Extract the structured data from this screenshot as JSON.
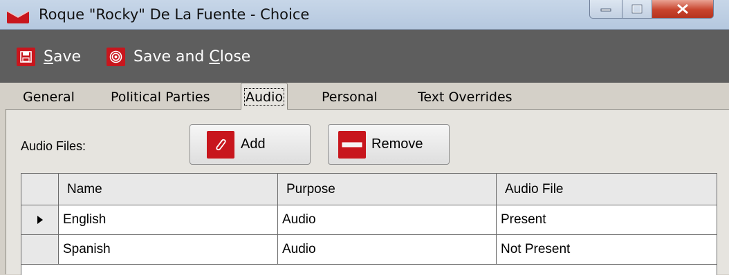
{
  "window": {
    "title": "Roque \"Rocky\" De La Fuente - Choice"
  },
  "toolbar": {
    "save_prefix": "",
    "save_mnemonic": "S",
    "save_rest": "ave",
    "saveclose_prefix": "Save and ",
    "saveclose_mnemonic": "C",
    "saveclose_rest": "lose"
  },
  "tabs": [
    {
      "label": "General"
    },
    {
      "label": "Political Parties"
    },
    {
      "label": "Audio"
    },
    {
      "label": "Personal"
    },
    {
      "label": "Text Overrides"
    }
  ],
  "active_tab": "Audio",
  "audio": {
    "label": "Audio Files:",
    "add_label": "Add",
    "remove_label": "Remove"
  },
  "grid": {
    "columns": [
      "Name",
      "Purpose",
      "Audio File"
    ],
    "rows": [
      {
        "name": "English",
        "purpose": "Audio",
        "audio_file": "Present",
        "current": true
      },
      {
        "name": "Spanish",
        "purpose": "Audio",
        "audio_file": "Not Present",
        "current": false
      }
    ]
  },
  "icons": {
    "app": "envelope-logo-icon",
    "save": "floppy-disk-icon",
    "save_close": "target-icon",
    "add": "paperclip-icon",
    "remove": "minus-bar-icon"
  },
  "colors": {
    "accent_red": "#c8161d",
    "toolbar_bg": "#5e5e5e",
    "panel_bg": "#e6e4df"
  }
}
